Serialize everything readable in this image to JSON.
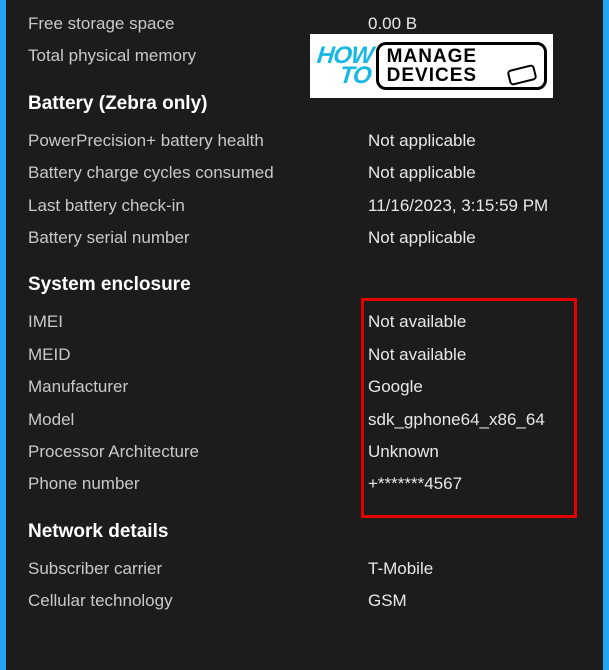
{
  "storage": {
    "free_space_label": "Free storage space",
    "free_space_value": "0.00 B",
    "total_memory_label": "Total physical memory",
    "total_memory_value": ""
  },
  "battery": {
    "section_title": "Battery (Zebra only)",
    "health_label": "PowerPrecision+ battery health",
    "health_value": "Not applicable",
    "cycles_label": "Battery charge cycles consumed",
    "cycles_value": "Not applicable",
    "checkin_label": "Last battery check-in",
    "checkin_value": "11/16/2023, 3:15:59 PM",
    "serial_label": "Battery serial number",
    "serial_value": "Not applicable"
  },
  "enclosure": {
    "section_title": "System enclosure",
    "imei_label": "IMEI",
    "imei_value": "Not available",
    "meid_label": "MEID",
    "meid_value": "Not available",
    "manufacturer_label": "Manufacturer",
    "manufacturer_value": "Google",
    "model_label": "Model",
    "model_value": "sdk_gphone64_x86_64",
    "arch_label": "Processor Architecture",
    "arch_value": "Unknown",
    "phone_label": "Phone number",
    "phone_value": "+*******4567"
  },
  "network": {
    "section_title": "Network details",
    "carrier_label": "Subscriber carrier",
    "carrier_value": "T-Mobile",
    "tech_label": "Cellular technology",
    "tech_value": "GSM"
  },
  "logo": {
    "how": "HOW",
    "to": "TO",
    "line1": "MANAGE",
    "line2": "DEVICES"
  }
}
